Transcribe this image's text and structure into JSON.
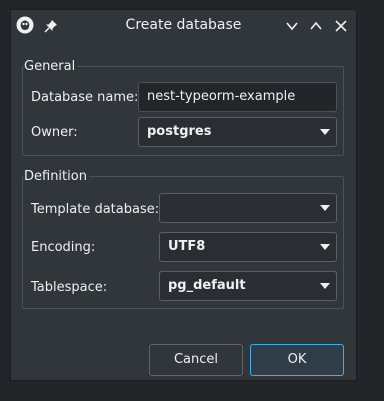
{
  "window": {
    "title": "Create database"
  },
  "icons": {
    "app": "app-icon",
    "pin": "pin-icon",
    "minimize": "chevron-down-icon",
    "maximize": "chevron-up-icon",
    "close": "close-icon",
    "dropdown": "chevron-down-icon"
  },
  "general": {
    "title": "General",
    "database_name_label": "Database name:",
    "database_name_value": "nest-typeorm-example",
    "owner_label": "Owner:",
    "owner_value": "postgres"
  },
  "definition": {
    "title": "Definition",
    "template_label": "Template database:",
    "template_value": "",
    "encoding_label": "Encoding:",
    "encoding_value": "UTF8",
    "tablespace_label": "Tablespace:",
    "tablespace_value": "pg_default"
  },
  "buttons": {
    "cancel_label": "Cancel",
    "ok_label": "OK"
  },
  "colors": {
    "window_bg": "#31363b",
    "text": "#eff0f1",
    "accent": "#3daee9",
    "border": "#4d5257"
  }
}
